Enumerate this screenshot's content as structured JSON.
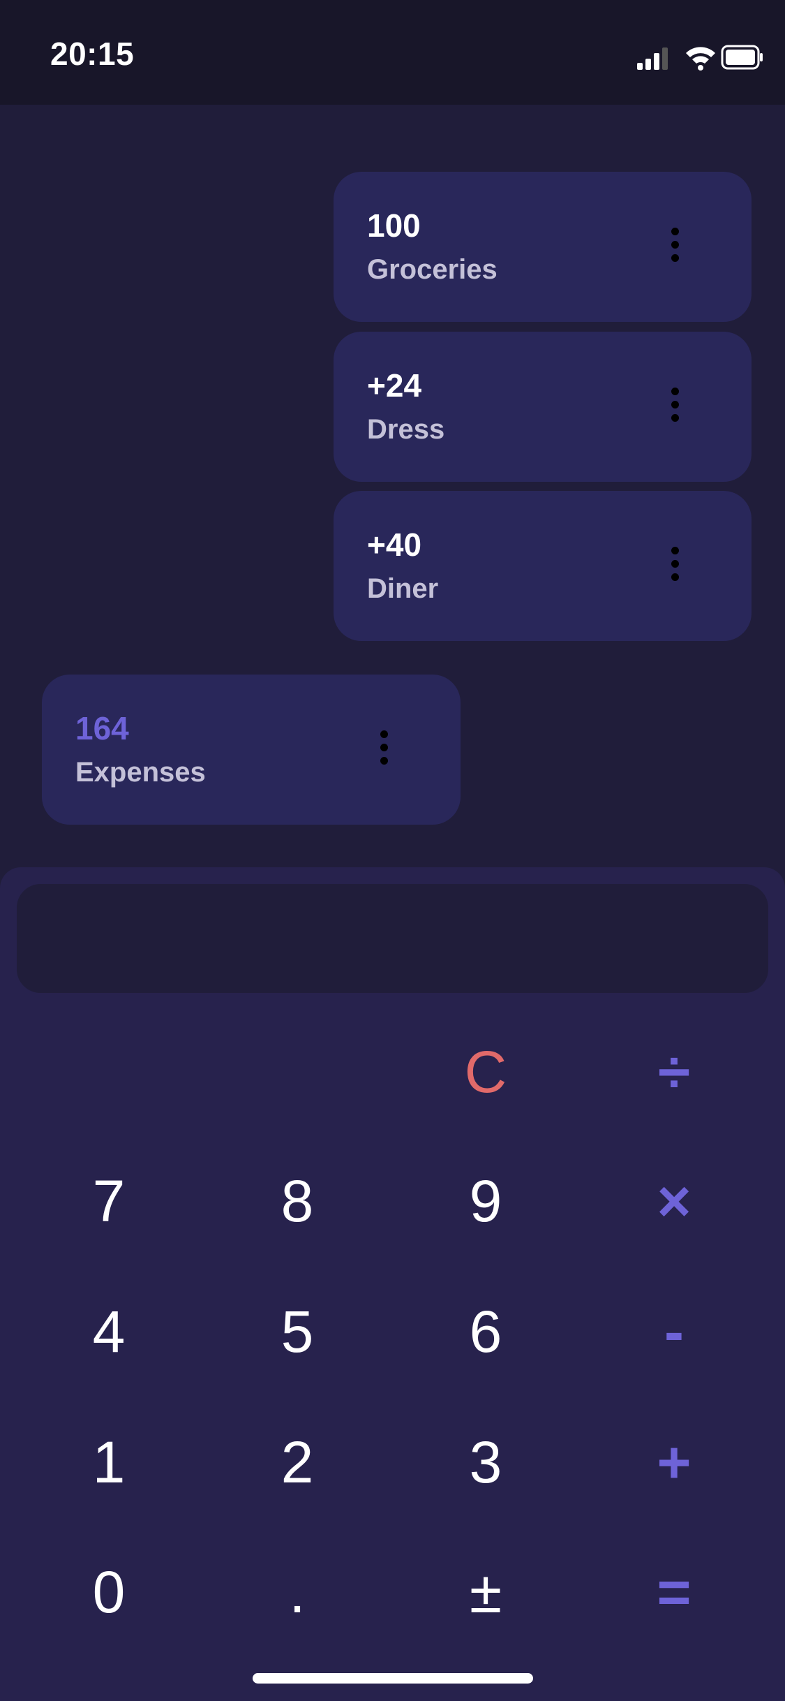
{
  "status_bar": {
    "time": "20:15"
  },
  "items": [
    {
      "amount": "100",
      "label": "Groceries"
    },
    {
      "amount": "+24",
      "label": "Dress"
    },
    {
      "amount": "+40",
      "label": "Diner"
    }
  ],
  "total": {
    "amount": "164",
    "label": "Expenses"
  },
  "display": {
    "value": ""
  },
  "keys": {
    "clear": "C",
    "divide": "÷",
    "seven": "7",
    "eight": "8",
    "nine": "9",
    "multiply": "×",
    "four": "4",
    "five": "5",
    "six": "6",
    "minus": "-",
    "one": "1",
    "two": "2",
    "three": "3",
    "plus": "+",
    "zero": "0",
    "dot": ".",
    "plusminus": "±",
    "equals": "="
  },
  "colors": {
    "background": "#201d3a",
    "card": "#29275a",
    "accent": "#6e63d8",
    "clear": "#e16a6a",
    "label": "#c4c1d8"
  },
  "icons": [
    "cellular-signal-icon",
    "wifi-icon",
    "battery-icon",
    "more-vertical-icon"
  ]
}
